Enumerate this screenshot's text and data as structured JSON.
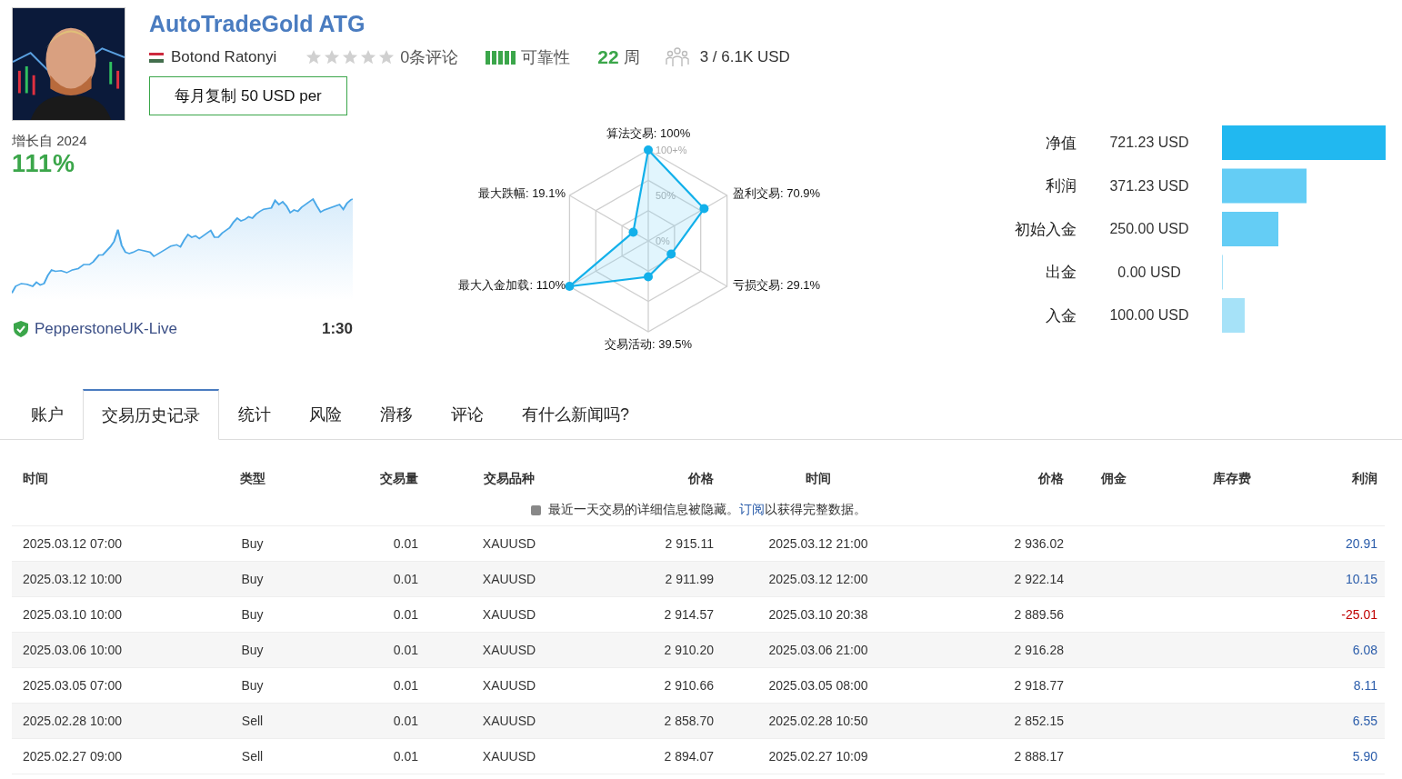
{
  "header": {
    "title": "AutoTradeGold ATG",
    "author": "Botond Ratonyi",
    "stars": 0,
    "reviews": "0条评论",
    "reliability": "可靠性",
    "weeks_value": "22",
    "weeks_unit": "周",
    "subscribers": "3 / 6.1K USD",
    "copy_button": "每月复制 50 USD per"
  },
  "growth": {
    "label": "增长自 2024",
    "value": "111%",
    "broker": "PepperstoneUK-Live",
    "leverage": "1:30"
  },
  "radar": {
    "ring_labels": [
      "100+%",
      "50%",
      "0%"
    ],
    "axes": [
      {
        "label": "算法交易: 100%"
      },
      {
        "label": "最大跌幅: 19.1%"
      },
      {
        "label": "盈利交易: 70.9%"
      },
      {
        "label": "最大入金加载: 110%"
      },
      {
        "label": "亏损交易: 29.1%"
      },
      {
        "label": "交易活动: 39.5%"
      }
    ]
  },
  "balances": [
    {
      "label": "净值",
      "value": "721.23 USD",
      "color": "#21b8f0"
    },
    {
      "label": "利润",
      "value": "371.23 USD",
      "color": "#64cdf5"
    },
    {
      "label": "初始入金",
      "value": "250.00 USD",
      "color": "#64cdf5"
    },
    {
      "label": "出金",
      "value": "0.00 USD",
      "color": "#a6e2f8"
    },
    {
      "label": "入金",
      "value": "100.00 USD",
      "color": "#a6e2f8"
    }
  ],
  "tabs": [
    {
      "label": "账户",
      "selected": false
    },
    {
      "label": "交易历史记录",
      "selected": true
    },
    {
      "label": "统计",
      "selected": false
    },
    {
      "label": "风险",
      "selected": false
    },
    {
      "label": "滑移",
      "selected": false
    },
    {
      "label": "评论",
      "selected": false
    },
    {
      "label": "有什么新闻吗?",
      "selected": false
    }
  ],
  "table": {
    "columns": [
      "时间",
      "类型",
      "交易量",
      "交易品种",
      "价格",
      "时间",
      "价格",
      "佣金",
      "库存费",
      "利润"
    ],
    "notice": {
      "before": "最近一天交易的详细信息被隐藏。",
      "link": "订阅",
      "after": "以获得完整数据。"
    },
    "rows": [
      {
        "cells": [
          "2025.03.12 07:00",
          "Buy",
          "0.01",
          "XAUUSD",
          "2 915.11",
          "2025.03.12 21:00",
          "2 936.02",
          "",
          "",
          "20.91"
        ],
        "color": "#2a5caa"
      },
      {
        "cells": [
          "2025.03.12 10:00",
          "Buy",
          "0.01",
          "XAUUSD",
          "2 911.99",
          "2025.03.12 12:00",
          "2 922.14",
          "",
          "",
          "10.15"
        ],
        "color": "#2a5caa"
      },
      {
        "cells": [
          "2025.03.10 10:00",
          "Buy",
          "0.01",
          "XAUUSD",
          "2 914.57",
          "2025.03.10 20:38",
          "2 889.56",
          "",
          "",
          "-25.01"
        ],
        "color": "#c00000"
      },
      {
        "cells": [
          "2025.03.06 10:00",
          "Buy",
          "0.01",
          "XAUUSD",
          "2 910.20",
          "2025.03.06 21:00",
          "2 916.28",
          "",
          "",
          "6.08"
        ],
        "color": "#2a5caa"
      },
      {
        "cells": [
          "2025.03.05 07:00",
          "Buy",
          "0.01",
          "XAUUSD",
          "2 910.66",
          "2025.03.05 08:00",
          "2 918.77",
          "",
          "",
          "8.11"
        ],
        "color": "#2a5caa"
      },
      {
        "cells": [
          "2025.02.28 10:00",
          "Sell",
          "0.01",
          "XAUUSD",
          "2 858.70",
          "2025.02.28 10:50",
          "2 852.15",
          "",
          "",
          "6.55"
        ],
        "color": "#2a5caa"
      },
      {
        "cells": [
          "2025.02.27 09:00",
          "Sell",
          "0.01",
          "XAUUSD",
          "2 894.07",
          "2025.02.27 10:09",
          "2 888.17",
          "",
          "",
          "5.90"
        ],
        "color": "#2a5caa"
      }
    ]
  }
}
